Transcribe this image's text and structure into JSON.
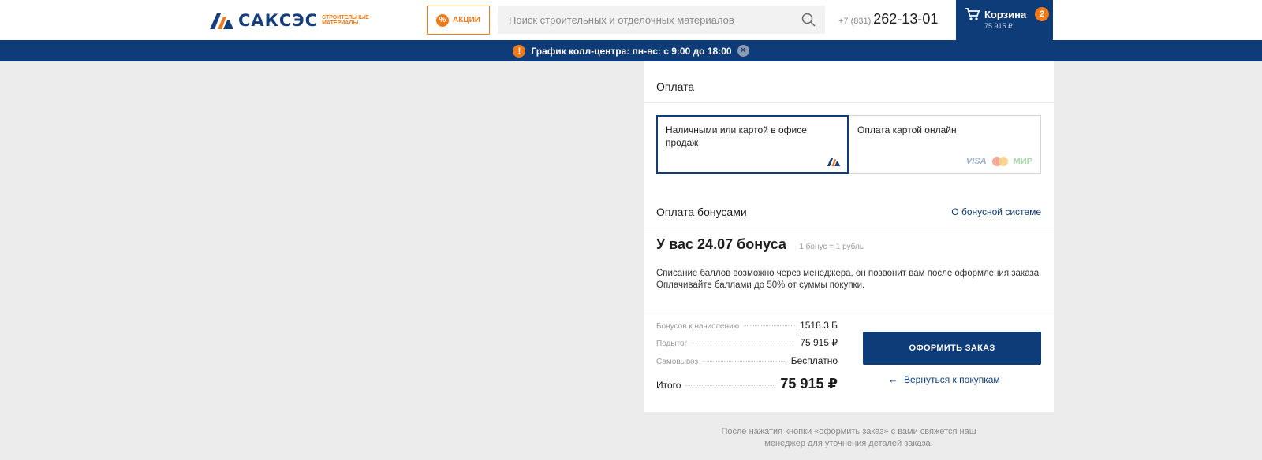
{
  "header": {
    "logo_text": "САКСЭС",
    "logo_sub": "строительные материалы",
    "promo_label": "Акции",
    "search_placeholder": "Поиск строительных и отделочных материалов",
    "phone_code": "+7 (831)",
    "phone_number": "262-13-01",
    "cart_label": "Корзина",
    "cart_count": "2",
    "cart_total": "75 915 ₽"
  },
  "infobar": {
    "text": "График колл-центра: пн-вс: с 9:00 до 18:00"
  },
  "payment": {
    "title": "Оплата",
    "options": [
      {
        "label": "Наличными или картой в офисе продаж",
        "selected": true
      },
      {
        "label": "Оплата картой онлайн",
        "selected": false
      }
    ],
    "card_brands": {
      "visa": "VISA",
      "mir": "МИР"
    }
  },
  "bonus": {
    "title": "Оплата бонусами",
    "link": "О бонусной системе",
    "balance_text": "У вас 24.07 бонуса",
    "rate_text": "1 бонус = 1 рубль",
    "description": "Списание баллов возможно через менеджера, он позвонит вам после оформления заказа. Оплачивайте баллами до 50% от суммы покупки."
  },
  "summary": {
    "rows": [
      {
        "label": "Бонусов к начислению",
        "value": "1518.3 Б"
      },
      {
        "label": "Подытог",
        "value": "75 915 ₽"
      },
      {
        "label": "Самовывоз",
        "value": "Бесплатно"
      }
    ],
    "total_label": "Итого",
    "total_value": "75 915 ₽"
  },
  "actions": {
    "order_label": "Оформить заказ",
    "back_label": "Вернуться к покупкам"
  },
  "footnote": "После нажатия кнопки «оформить заказ» с вами свяжется наш менеджер для уточнения деталей заказа.",
  "colors": {
    "brand_blue": "#0e3c79",
    "accent_orange": "#f07a1a"
  }
}
